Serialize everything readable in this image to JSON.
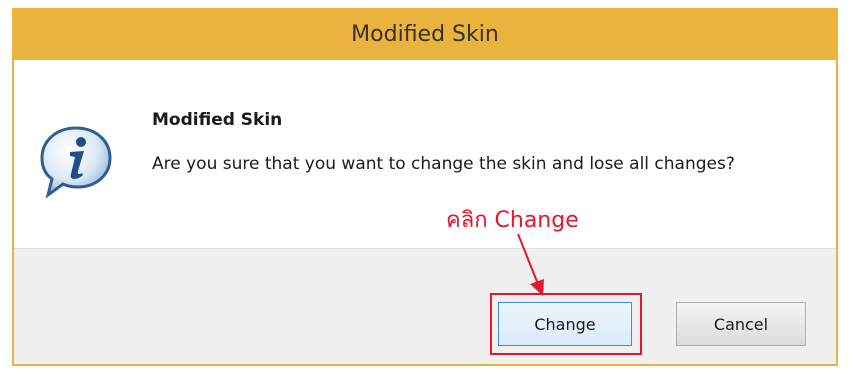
{
  "window": {
    "title": "Modified Skin"
  },
  "dialog": {
    "heading": "Modified Skin",
    "message": "Are you sure that you want to change the skin and lose all changes?",
    "icon": "info-icon"
  },
  "annotation": {
    "text": "คลิก Change",
    "color": "#e8162a"
  },
  "buttons": {
    "change_label": "Change",
    "cancel_label": "Cancel"
  },
  "colors": {
    "titlebar": "#e9b33d",
    "focus_border": "#3c8fe0"
  }
}
